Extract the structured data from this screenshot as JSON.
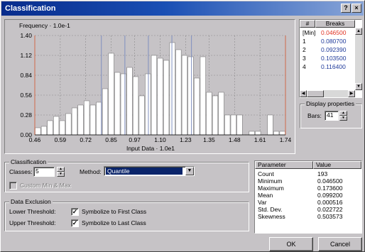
{
  "window": {
    "title": "Classification",
    "help_label": "?",
    "close_label": "×"
  },
  "histogram": {
    "ylabel": "Frequency · 1.0e-1",
    "xlabel": "Input Data · 1.0e1"
  },
  "chart_data": {
    "type": "bar",
    "title": "",
    "xlabel": "Input Data · 1.0e1",
    "ylabel": "Frequency · 1.0e-1",
    "xlim": [
      0.46,
      1.74
    ],
    "ylim": [
      0,
      1.4
    ],
    "x_ticks": [
      "0.46",
      "0.59",
      "0.72",
      "0.85",
      "0.97",
      "1.10",
      "1.23",
      "1.35",
      "1.48",
      "1.61",
      "1.74"
    ],
    "y_ticks": [
      "0.00",
      "0.28",
      "0.56",
      "0.84",
      "1.12",
      "1.40"
    ],
    "grid": true,
    "bin_count": 41,
    "values": [
      0.1,
      0.12,
      0.2,
      0.26,
      0.2,
      0.3,
      0.38,
      0.42,
      0.48,
      0.42,
      0.46,
      0.65,
      1.15,
      0.88,
      0.86,
      0.95,
      0.82,
      0.55,
      0.86,
      1.12,
      1.08,
      1.05,
      1.3,
      1.2,
      1.12,
      1.1,
      0.8,
      1.1,
      0.6,
      0.55,
      0.6,
      0.28,
      0.28,
      0.28,
      0,
      0.05,
      0.05,
      0,
      0.28,
      0.05,
      0.05
    ],
    "break_lines": [
      0.8,
      0.92,
      1.04,
      1.16,
      1.26
    ],
    "break_color": "#7f8fbf",
    "bound_color": "#d06a4a"
  },
  "breaks": {
    "col_index": "#",
    "col_breaks": "Breaks",
    "rows": [
      {
        "index": "[Min]",
        "value": "0.046500",
        "color": "#e03020"
      },
      {
        "index": "1",
        "value": "0.080700",
        "color": "#1f3a9a"
      },
      {
        "index": "2",
        "value": "0.092390",
        "color": "#1f3a9a"
      },
      {
        "index": "3",
        "value": "0.103500",
        "color": "#1f3a9a"
      },
      {
        "index": "4",
        "value": "0.116400",
        "color": "#1f3a9a"
      }
    ]
  },
  "display": {
    "group_label": "Display properties",
    "bars_label": "Bars:",
    "bars_value": "41"
  },
  "classification": {
    "group_label": "Classification",
    "classes_label": "Classes:",
    "classes_value": "5",
    "method_label": "Method:",
    "method_value": "Quantile",
    "custom_label": "Custom Min & Max"
  },
  "exclusion": {
    "group_label": "Data Exclusion",
    "lower_label": "Lower Threshold:",
    "lower_check": "Symbolize to First Class",
    "upper_label": "Upper Threshold:",
    "upper_check": "Symbolize to Last Class"
  },
  "stats": {
    "col_param": "Parameter",
    "col_value": "Value",
    "rows": [
      {
        "name": "Count",
        "value": "193"
      },
      {
        "name": "Minimum",
        "value": "0.046500"
      },
      {
        "name": "Maximum",
        "value": "0.173600"
      },
      {
        "name": "Mean",
        "value": "0.099200"
      },
      {
        "name": "Var",
        "value": "0.000516"
      },
      {
        "name": "Std. Dev.",
        "value": "0.022722"
      },
      {
        "name": "Skewness",
        "value": "0.503573"
      }
    ]
  },
  "buttons": {
    "ok": "OK",
    "cancel": "Cancel"
  }
}
